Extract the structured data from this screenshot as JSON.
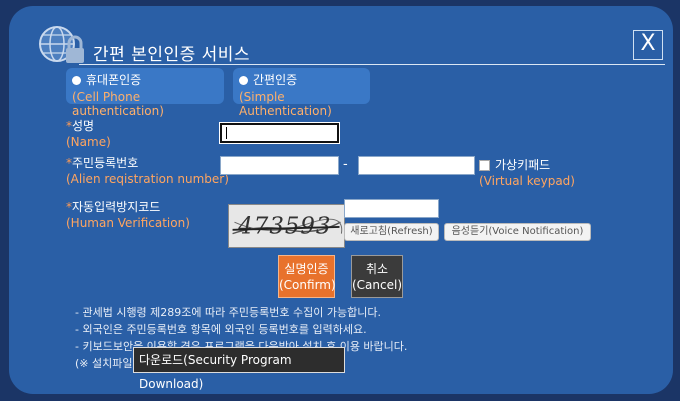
{
  "dialog": {
    "title": "간편 본인인증 서비스",
    "close_glyph": "X"
  },
  "auth_options": [
    {
      "label": "휴대폰인증",
      "sub": "(Cell Phone authentication)"
    },
    {
      "label": "간편인증",
      "sub": "(Simple Authentication)"
    }
  ],
  "form": {
    "name": {
      "label": "성명",
      "sub": "(Name)",
      "value": ""
    },
    "rrn": {
      "label": "주민등록번호",
      "sub": "(Alien reqistration number)",
      "first": "",
      "second": "",
      "separator": "-"
    },
    "keypad": {
      "label": "가상키패드",
      "sub": "(Virtual keypad)"
    },
    "captcha": {
      "label": "자동입력방지코드",
      "sub": "(Human Verification)",
      "image_text": "473593",
      "value": "",
      "refresh_label": "새로고침",
      "refresh_sub": "(Refresh)",
      "voice_label": "음성듣기",
      "voice_sub": "(Voice Notification)"
    },
    "star": "*"
  },
  "buttons": {
    "confirm": {
      "label": "실명인증",
      "sub": "(Confirm)"
    },
    "cancel": {
      "label": "취소",
      "sub": "(Cancel)"
    }
  },
  "notes": [
    "- 관세법 시행령 제289조에 따라 주민등록번호 수집이 가능합니다.",
    "- 외국인은 주민등록번호 항목에 외국인 등록번호를 입력하세요.",
    "- 키보드보안을 이용할 경우 프로그램을 다운받아 설치 후 이용 바랍니다."
  ],
  "install_note": "(※ 설치파일",
  "download_tip": "다운로드(Security Program Download)",
  "colors": {
    "dialog_bg": "#2a5fa6",
    "accent_orange": "#e8722c",
    "sub_text": "#ffa560",
    "cancel_bg": "#3b3b3b"
  }
}
